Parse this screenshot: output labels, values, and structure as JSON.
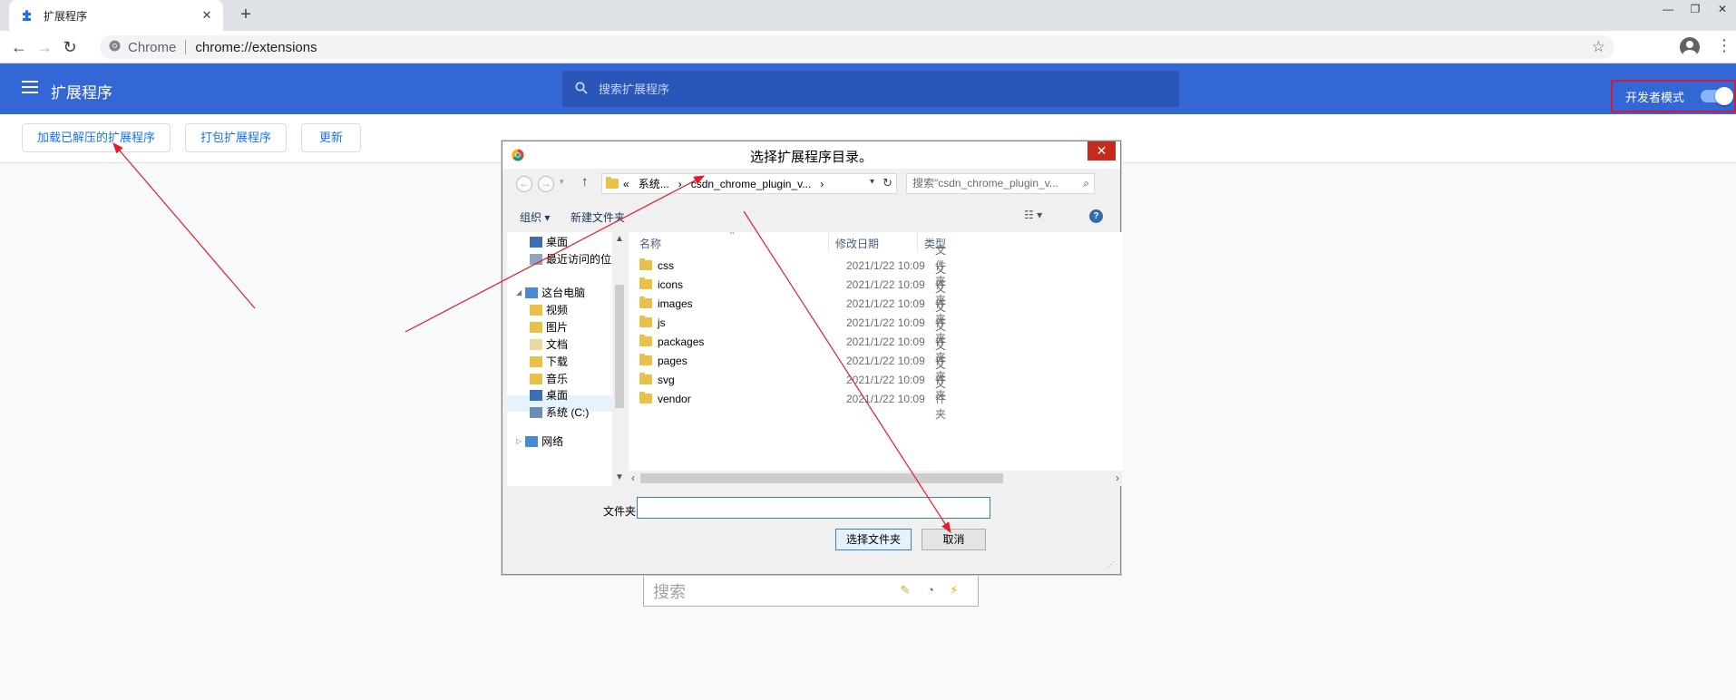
{
  "tab": {
    "title": "扩展程序",
    "close": "✕"
  },
  "new_tab": "+",
  "window_controls": [
    "—",
    "❐",
    "✕"
  ],
  "toolbar": {
    "site_chip": "Chrome",
    "url": "chrome://extensions"
  },
  "extensions_page": {
    "title": "扩展程序",
    "search_placeholder": "搜索扩展程序",
    "dev_mode_label": "开发者模式",
    "dev_mode_on": true,
    "actions": [
      "加载已解压的扩展程序",
      "打包扩展程序",
      "更新"
    ]
  },
  "dialog": {
    "title": "选择扩展程序目录。",
    "breadcrumb": [
      "«",
      "系统...",
      "›",
      "csdn_chrome_plugin_v...",
      "›"
    ],
    "search_placeholder": "搜索\"csdn_chrome_plugin_v...",
    "commands": {
      "organize": "组织 ▾",
      "new_folder": "新建文件夹"
    },
    "tree": [
      {
        "label": "桌面",
        "icon": "desktop-icon"
      },
      {
        "label": "最近访问的位置",
        "icon": "recent-icon"
      },
      {
        "label": "这台电脑",
        "icon": "computer-icon"
      },
      {
        "label": "视频",
        "icon": "video-folder-icon"
      },
      {
        "label": "图片",
        "icon": "pictures-folder-icon"
      },
      {
        "label": "文档",
        "icon": "documents-folder-icon"
      },
      {
        "label": "下载",
        "icon": "downloads-folder-icon"
      },
      {
        "label": "音乐",
        "icon": "music-folder-icon"
      },
      {
        "label": "桌面",
        "icon": "desktop-folder-icon"
      },
      {
        "label": "系统 (C:)",
        "icon": "drive-icon"
      },
      {
        "label": "网络",
        "icon": "network-icon"
      }
    ],
    "columns": {
      "name": "名称",
      "date": "修改日期",
      "type": "类型"
    },
    "files": [
      {
        "name": "css",
        "date": "2021/1/22 10:09",
        "type": "文件夹"
      },
      {
        "name": "icons",
        "date": "2021/1/22 10:09",
        "type": "文件夹"
      },
      {
        "name": "images",
        "date": "2021/1/22 10:09",
        "type": "文件夹"
      },
      {
        "name": "js",
        "date": "2021/1/22 10:09",
        "type": "文件夹"
      },
      {
        "name": "packages",
        "date": "2021/1/22 10:09",
        "type": "文件夹"
      },
      {
        "name": "pages",
        "date": "2021/1/22 10:09",
        "type": "文件夹"
      },
      {
        "name": "svg",
        "date": "2021/1/22 10:09",
        "type": "文件夹"
      },
      {
        "name": "vendor",
        "date": "2021/1/22 10:09",
        "type": "文件夹"
      }
    ],
    "folder_label": "文件夹:",
    "folder_value": "",
    "select_button": "选择文件夹",
    "cancel_button": "取消"
  },
  "bg_search": {
    "placeholder": "搜索"
  },
  "colors": {
    "header_blue": "#3367d6",
    "annotation_red": "#e8192c",
    "link_blue": "#1a73e8"
  }
}
